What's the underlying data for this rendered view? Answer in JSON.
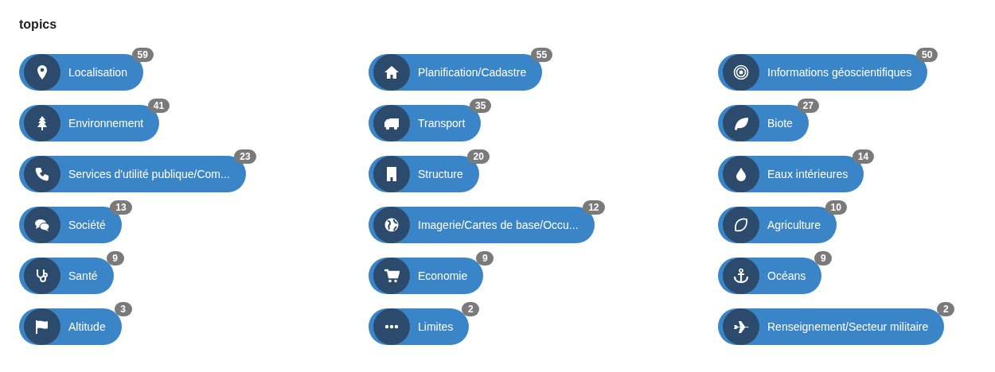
{
  "title": "topics",
  "topics": [
    {
      "label": "Localisation",
      "count": "59",
      "kind": "pin"
    },
    {
      "label": "Planification/Cadastre",
      "count": "55",
      "kind": "house"
    },
    {
      "label": "Informations géoscientifiques",
      "count": "50",
      "kind": "target"
    },
    {
      "label": "Environnement",
      "count": "41",
      "kind": "tree"
    },
    {
      "label": "Transport",
      "count": "35",
      "kind": "truck"
    },
    {
      "label": "Biote",
      "count": "27",
      "kind": "leaf"
    },
    {
      "label": "Services d'utilité publique/Com...",
      "count": "23",
      "kind": "phone"
    },
    {
      "label": "Structure",
      "count": "20",
      "kind": "building"
    },
    {
      "label": "Eaux intérieures",
      "count": "14",
      "kind": "drop"
    },
    {
      "label": "Société",
      "count": "13",
      "kind": "chat"
    },
    {
      "label": "Imagerie/Cartes de base/Occu...",
      "count": "12",
      "kind": "globe"
    },
    {
      "label": "Agriculture",
      "count": "10",
      "kind": "lemon"
    },
    {
      "label": "Santé",
      "count": "9",
      "kind": "stethoscope"
    },
    {
      "label": "Economie",
      "count": "9",
      "kind": "cart"
    },
    {
      "label": "Océans",
      "count": "9",
      "kind": "anchor"
    },
    {
      "label": "Altitude",
      "count": "3",
      "kind": "flag"
    },
    {
      "label": "Limites",
      "count": "2",
      "kind": "dots"
    },
    {
      "label": "Renseignement/Secteur militaire",
      "count": "2",
      "kind": "plane"
    }
  ]
}
